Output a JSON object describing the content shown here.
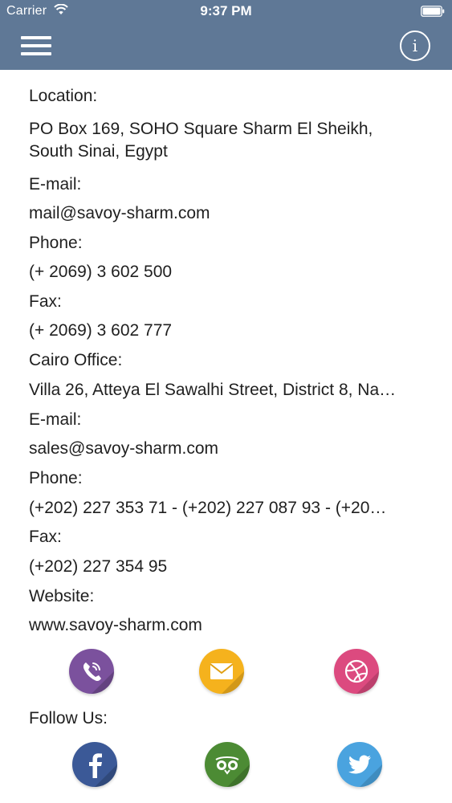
{
  "status_bar": {
    "carrier": "Carrier",
    "time": "9:37 PM"
  },
  "nav": {
    "menu_icon": "hamburger-menu-icon",
    "info_icon": "info-icon",
    "info_glyph": "i",
    "bar_color": "#5f7896"
  },
  "contact": {
    "location_label": "Location:",
    "location_value": "PO Box 169, SOHO Square Sharm El Sheikh, South Sinai, Egypt",
    "email_label": "E-mail:",
    "email_value": "mail@savoy-sharm.com",
    "phone_label": "Phone:",
    "phone_value": "(+ 2069) 3 602 500",
    "fax_label": "Fax:",
    "fax_value": "(+ 2069) 3 602 777",
    "cairo_label": "Cairo Office:",
    "cairo_value": "Villa 26, Atteya El Sawalhi Street, District 8, Na…",
    "cairo_email_label": "E-mail:",
    "cairo_email_value": "sales@savoy-sharm.com",
    "cairo_phone_label": "Phone:",
    "cairo_phone_value": "(+202) 227 353 71 - (+202) 227 087 93 - (+20…",
    "cairo_fax_label": "Fax:",
    "cairo_fax_value": "(+202) 227 354 95",
    "website_label": "Website:",
    "website_value": "www.savoy-sharm.com"
  },
  "contact_buttons": [
    {
      "icon": "viber-icon",
      "color": "#7b519d"
    },
    {
      "icon": "mail-icon",
      "color": "#f5b21d"
    },
    {
      "icon": "dribbble-icon",
      "color": "#dc4a7f"
    }
  ],
  "follow": {
    "label": "Follow Us:",
    "buttons": [
      {
        "icon": "facebook-icon",
        "color": "#3b5997"
      },
      {
        "icon": "tripadvisor-icon",
        "color": "#4c8b34"
      },
      {
        "icon": "twitter-icon",
        "color": "#4aa3df"
      }
    ]
  }
}
